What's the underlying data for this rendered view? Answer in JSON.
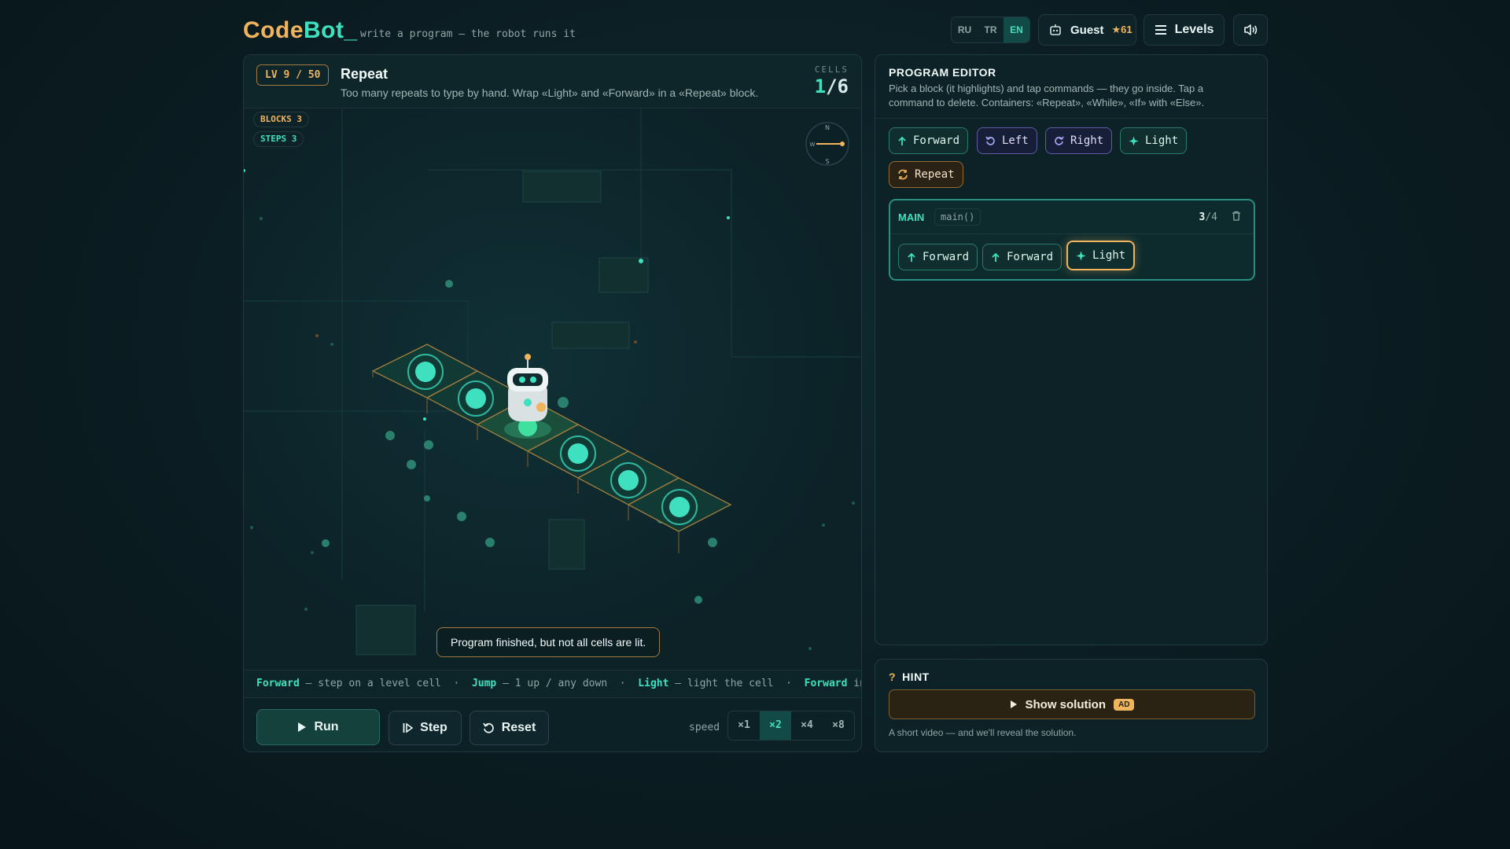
{
  "header": {
    "logo_code": "Code",
    "logo_bot": "Bot_",
    "tagline": "write a program — the robot runs it",
    "languages": [
      "RU",
      "TR",
      "EN"
    ],
    "active_language": "EN",
    "user_name": "Guest",
    "stars": "★61",
    "levels_label": "Levels"
  },
  "level": {
    "badge": "LV 9 / 50",
    "title": "Repeat",
    "description": "Too many repeats to type by hand. Wrap «Light» and «Forward» in a «Repeat» block.",
    "cells_label": "CELLS",
    "cells_lit": "1",
    "cells_total": "/6"
  },
  "stage": {
    "blocks_chip": "BLOCKS 3",
    "steps_chip": "STEPS 3",
    "compass": {
      "n": "N",
      "s": "S",
      "w": "W"
    },
    "toast": "Program finished, but not all cells are lit."
  },
  "command_help": [
    {
      "name": "Forward",
      "desc": "— step on a level cell"
    },
    {
      "name": "Jump",
      "desc": "— 1 up / any down"
    },
    {
      "name": "Light",
      "desc": "— light the cell"
    },
    {
      "name": "Forward",
      "desc": "into…"
    }
  ],
  "controls": {
    "run": "Run",
    "step": "Step",
    "reset": "Reset",
    "speed_label": "speed",
    "speeds": [
      "×1",
      "×2",
      "×4",
      "×8"
    ],
    "active_speed": "×2"
  },
  "editor": {
    "title": "PROGRAM EDITOR",
    "description": "Pick a block (it highlights) and tap commands — they go inside. Tap a command to delete. Containers: «Repeat», «While», «If» with «Else».",
    "palette": {
      "forward": "Forward",
      "left": "Left",
      "right": "Right",
      "light": "Light",
      "repeat": "Repeat"
    },
    "main": {
      "label": "MAIN",
      "fn": "main()",
      "count_used": "3",
      "count_max": "/4",
      "commands": [
        "Forward",
        "Forward",
        "Light"
      ]
    }
  },
  "hint": {
    "title": "HINT",
    "icon": "?",
    "button": "Show solution",
    "ad_badge": "AD",
    "note": "A short video — and we'll reveal the solution."
  },
  "colors": {
    "accent": "#3fe0c0",
    "brand_orange": "#f0b35e",
    "background": "#0b1d22"
  }
}
